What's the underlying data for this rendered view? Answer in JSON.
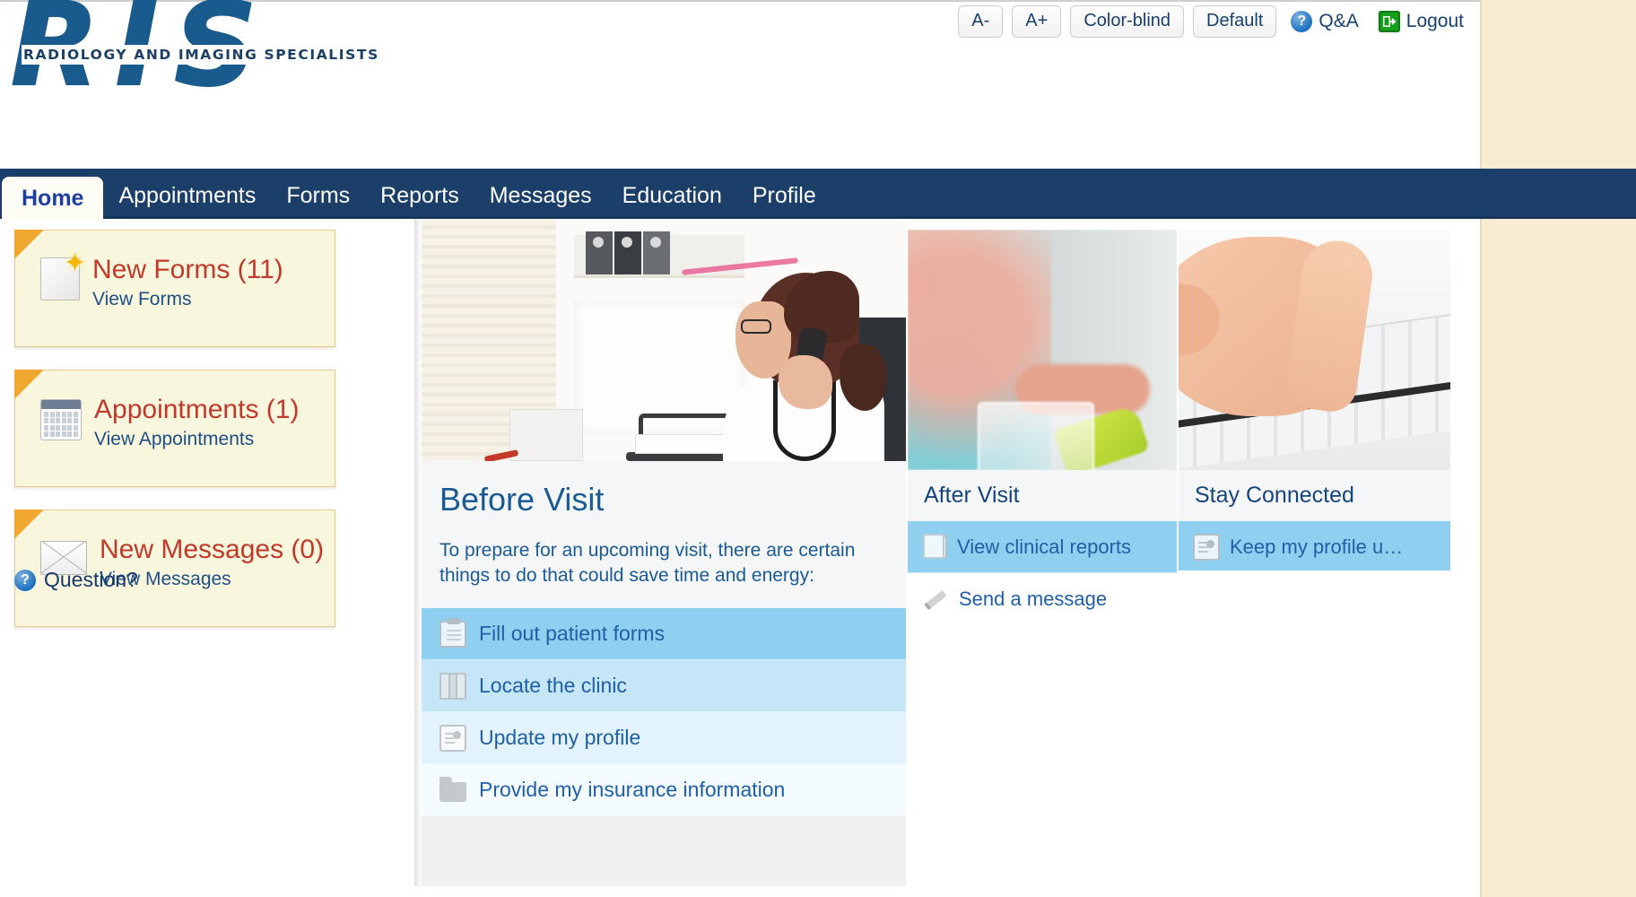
{
  "brand": {
    "logo_letters": "RIS",
    "logo_subtitle": "RADIOLOGY AND IMAGING SPECIALISTS",
    "accent_blue": "#1a5b8e",
    "nav_navy": "#1c3f6a",
    "alert_red": "#c0392b",
    "card_cream": "#f8f6dc",
    "page_beige": "#f8edd2"
  },
  "toolbar": {
    "font_decrease": "A-",
    "font_increase": "A+",
    "color_blind": "Color-blind",
    "default_theme": "Default",
    "qa_label": "Q&A",
    "qa_icon": "help-icon",
    "logout_label": "Logout",
    "logout_icon": "exit-icon"
  },
  "nav": {
    "tabs": [
      {
        "label": "Home",
        "active": true
      },
      {
        "label": "Appointments",
        "active": false
      },
      {
        "label": "Forms",
        "active": false
      },
      {
        "label": "Reports",
        "active": false
      },
      {
        "label": "Messages",
        "active": false
      },
      {
        "label": "Education",
        "active": false
      },
      {
        "label": "Profile",
        "active": false
      }
    ]
  },
  "sidebar": {
    "cards": [
      {
        "title": "New Forms (11)",
        "link": "View Forms",
        "icon": "new-document-icon",
        "count": 11
      },
      {
        "title": "Appointments (1)",
        "link": "View Appointments",
        "icon": "calendar-icon",
        "count": 1
      },
      {
        "title": "New Messages (0)",
        "link": "View Messages",
        "icon": "envelope-icon",
        "count": 0
      }
    ],
    "question": {
      "label": "Question?",
      "icon": "help-icon"
    }
  },
  "panels": {
    "before_visit": {
      "title": "Before Visit",
      "description": "To prepare for an upcoming visit, there are certain things to do that could save time and energy:",
      "image": "doctor-on-phone-photo",
      "links": [
        {
          "label": "Fill out patient forms",
          "icon": "clipboard-icon"
        },
        {
          "label": "Locate the clinic",
          "icon": "map-icon"
        },
        {
          "label": "Update my profile",
          "icon": "id-card-icon"
        },
        {
          "label": "Provide my insurance information",
          "icon": "folder-icon"
        }
      ]
    },
    "after_visit": {
      "title": "After Visit",
      "image": "clinician-with-cup-photo",
      "links": [
        {
          "label": "View clinical reports",
          "icon": "copy-documents-icon"
        },
        {
          "label": "Send a message",
          "icon": "pencil-icon"
        }
      ]
    },
    "stay_connected": {
      "title": "Stay Connected",
      "image": "hand-typing-on-keyboard-photo",
      "links": [
        {
          "label": "Keep my profile u…",
          "icon": "id-card-icon"
        }
      ]
    }
  }
}
